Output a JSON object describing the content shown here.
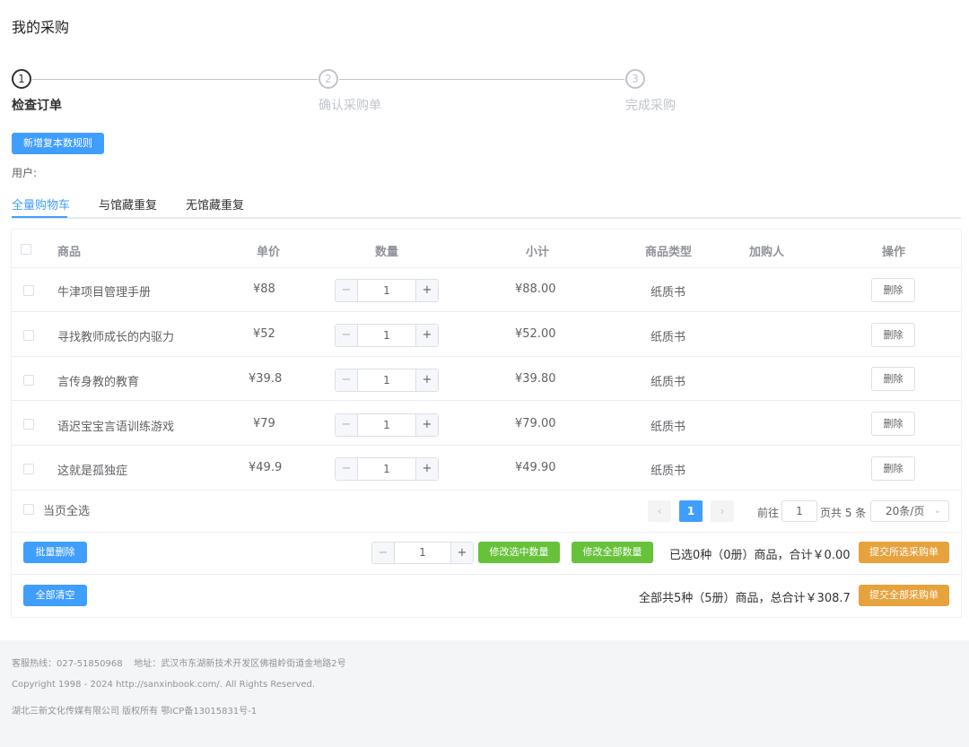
{
  "header": {
    "title": "我的采购"
  },
  "steps": [
    {
      "num": "1",
      "label": "检查订单"
    },
    {
      "num": "2",
      "label": "确认采购单"
    },
    {
      "num": "3",
      "label": "完成采购"
    }
  ],
  "add_rule_button": "新增复本数规则",
  "user_label": "用户:",
  "tabs": [
    "全量购物车",
    "与馆藏重复",
    "无馆藏重复"
  ],
  "table": {
    "headers": {
      "product": "商品",
      "price": "单价",
      "quantity": "数量",
      "subtotal": "小计",
      "type": "商品类型",
      "buyer": "加购人",
      "action": "操作"
    },
    "rows": [
      {
        "name": "牛津项目管理手册",
        "price": "¥88",
        "qty": "1",
        "subtotal": "¥88.00",
        "type": "纸质书",
        "buyer": "",
        "action": "删除"
      },
      {
        "name": "寻找教师成长的内驱力",
        "price": "¥52",
        "qty": "1",
        "subtotal": "¥52.00",
        "type": "纸质书",
        "buyer": "",
        "action": "删除"
      },
      {
        "name": "言传身教的教育",
        "price": "¥39.8",
        "qty": "1",
        "subtotal": "¥39.80",
        "type": "纸质书",
        "buyer": "",
        "action": "删除"
      },
      {
        "name": "语迟宝宝言语训练游戏",
        "price": "¥79",
        "qty": "1",
        "subtotal": "¥79.00",
        "type": "纸质书",
        "buyer": "",
        "action": "删除"
      },
      {
        "name": "这就是孤独症",
        "price": "¥49.9",
        "qty": "1",
        "subtotal": "¥49.90",
        "type": "纸质书",
        "buyer": "",
        "action": "删除"
      }
    ]
  },
  "select_all_label": "当页全选",
  "pagination": {
    "prev": "‹",
    "current_page": "1",
    "next": "›",
    "goto_label": "前往",
    "goto_value": "1",
    "total_text": "页共 5 条",
    "page_size": "20条/页"
  },
  "bulk": {
    "batch_delete": "批量删除",
    "qty_value": "1",
    "modify_selected": "修改选中数量",
    "modify_all": "修改全部数量",
    "selected_summary": "已选0种（0册）商品，合计￥0.00",
    "submit_selected": "提交所选采购单",
    "clear_all": "全部清空",
    "total_summary": "全部共5种（5册）商品，总合计￥308.7",
    "submit_all": "提交全部采购单"
  },
  "footer": {
    "line1": "客服热线：027-51850968    地址：武汉市东湖新技术开发区佛祖岭街道金地路2号",
    "line2": "Copyright 1998 - 2024 http://sanxinbook.com/. All Rights Reserved.",
    "line3": "湖北三新文化传媒有限公司 版权所有 鄂ICP备13015831号-1"
  },
  "colors": {
    "accent": "#409eff",
    "green": "#67c23a",
    "orange": "#e6a23c"
  }
}
